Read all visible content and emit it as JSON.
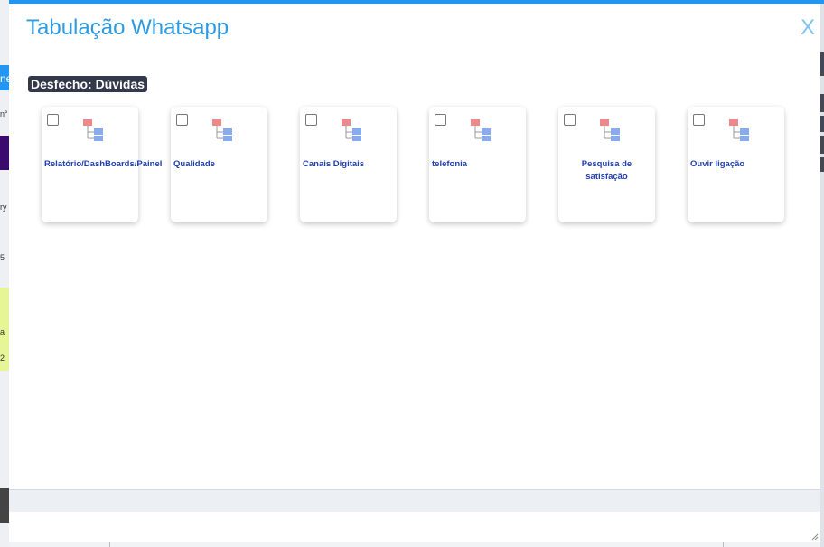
{
  "modal": {
    "title": "Tabulação Whatsapp",
    "close_label": "X",
    "outcome_label": "Desfecho: Dúvidas",
    "options": [
      {
        "label": "Relatório/DashBoards/Painel"
      },
      {
        "label": "Qualidade"
      },
      {
        "label": "Canais Digitais"
      },
      {
        "label": "telefonia"
      },
      {
        "label": "Pesquisa de satisfação"
      },
      {
        "label": "Ouvir ligação"
      }
    ]
  },
  "background": {
    "fragment_1": "ne",
    "fragment_2": "n°",
    "fragment_3": "ry",
    "fragment_4": "5",
    "fragment_5": "a",
    "fragment_6": "2"
  },
  "colors": {
    "accent": "#2e9be0",
    "label_bg": "#33384a",
    "option_text": "#1f3fb2"
  },
  "icons": {
    "option_icon": "hierarchy-tree-icon",
    "close_icon": "close-x-icon",
    "resize": "resize-grip-icon"
  }
}
